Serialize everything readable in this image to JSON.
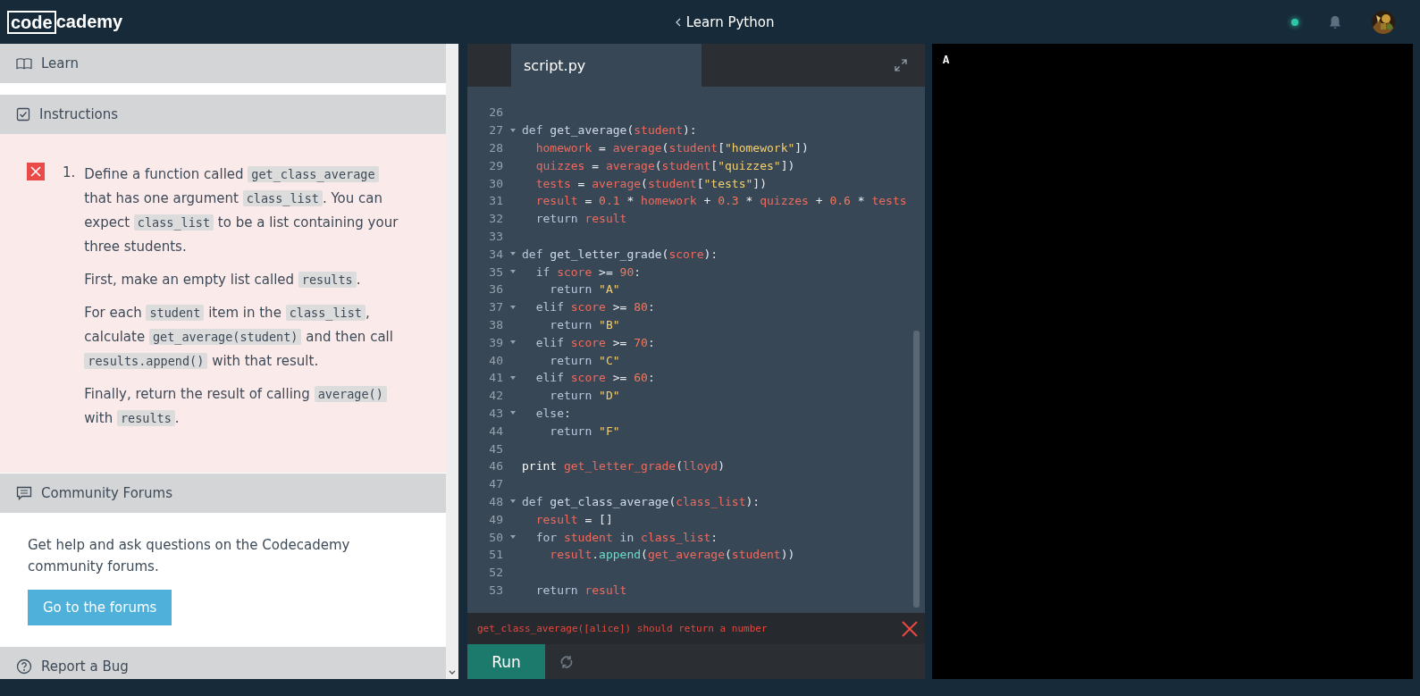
{
  "header": {
    "logo_box": "code",
    "logo_rest": "cademy",
    "course": "Learn Python",
    "online": true
  },
  "sidebar": {
    "learn": {
      "title": "Learn"
    },
    "instructions": {
      "title": "Instructions",
      "items": [
        {
          "number": "1.",
          "passed": false,
          "paragraphs": [
            [
              {
                "text": "Define a function called ",
                "kind": "plain"
              },
              {
                "text": "get_class_average",
                "kind": "code"
              },
              {
                "text": " that has one argument ",
                "kind": "plain"
              },
              {
                "text": "class_list",
                "kind": "code"
              },
              {
                "text": ". You can expect ",
                "kind": "plain"
              },
              {
                "text": "class_list",
                "kind": "code"
              },
              {
                "text": " to be a list containing your three students.",
                "kind": "plain"
              }
            ],
            [
              {
                "text": "First, make an empty list called ",
                "kind": "plain"
              },
              {
                "text": "results",
                "kind": "code"
              },
              {
                "text": ".",
                "kind": "plain"
              }
            ],
            [
              {
                "text": "For each ",
                "kind": "plain"
              },
              {
                "text": "student",
                "kind": "code"
              },
              {
                "text": " item in the ",
                "kind": "plain"
              },
              {
                "text": "class_list",
                "kind": "code"
              },
              {
                "text": ", calculate ",
                "kind": "plain"
              },
              {
                "text": "get_average(student)",
                "kind": "code"
              },
              {
                "text": " and then call ",
                "kind": "plain"
              },
              {
                "text": "results.append()",
                "kind": "code"
              },
              {
                "text": " with that result.",
                "kind": "plain"
              }
            ],
            [
              {
                "text": "Finally, return the result of calling ",
                "kind": "plain"
              },
              {
                "text": "average()",
                "kind": "code"
              },
              {
                "text": " with ",
                "kind": "plain"
              },
              {
                "text": "results",
                "kind": "code"
              },
              {
                "text": ".",
                "kind": "plain"
              }
            ]
          ]
        }
      ]
    },
    "community": {
      "title": "Community Forums",
      "text": "Get help and ask questions on the Codecademy community forums.",
      "button": "Go to the forums"
    },
    "report": {
      "title": "Report a Bug"
    }
  },
  "editor": {
    "tab": "script.py",
    "lines": [
      {
        "n": "26",
        "fold": false
      },
      {
        "n": "27",
        "fold": true,
        "tokens": [
          {
            "text": "def ",
            "kind": "kw"
          },
          {
            "text": "get_average",
            "kind": "fn"
          },
          {
            "text": "(",
            "kind": "p"
          },
          {
            "text": "student",
            "kind": "v"
          },
          {
            "text": "):",
            "kind": "p"
          }
        ]
      },
      {
        "n": "28",
        "fold": false,
        "tokens": [
          {
            "text": "  homework",
            "kind": "v"
          },
          {
            "text": " = ",
            "kind": "p"
          },
          {
            "text": "average",
            "kind": "v"
          },
          {
            "text": "(",
            "kind": "p"
          },
          {
            "text": "student",
            "kind": "v"
          },
          {
            "text": "[",
            "kind": "p"
          },
          {
            "text": "\"homework\"",
            "kind": "s"
          },
          {
            "text": "])",
            "kind": "p"
          }
        ]
      },
      {
        "n": "29",
        "fold": false,
        "tokens": [
          {
            "text": "  quizzes",
            "kind": "v"
          },
          {
            "text": " = ",
            "kind": "p"
          },
          {
            "text": "average",
            "kind": "v"
          },
          {
            "text": "(",
            "kind": "p"
          },
          {
            "text": "student",
            "kind": "v"
          },
          {
            "text": "[",
            "kind": "p"
          },
          {
            "text": "\"quizzes\"",
            "kind": "s"
          },
          {
            "text": "])",
            "kind": "p"
          }
        ]
      },
      {
        "n": "30",
        "fold": false,
        "tokens": [
          {
            "text": "  tests",
            "kind": "v"
          },
          {
            "text": " = ",
            "kind": "p"
          },
          {
            "text": "average",
            "kind": "v"
          },
          {
            "text": "(",
            "kind": "p"
          },
          {
            "text": "student",
            "kind": "v"
          },
          {
            "text": "[",
            "kind": "p"
          },
          {
            "text": "\"tests\"",
            "kind": "s"
          },
          {
            "text": "])",
            "kind": "p"
          }
        ]
      },
      {
        "n": "31",
        "fold": false,
        "tokens": [
          {
            "text": "  result",
            "kind": "v"
          },
          {
            "text": " = ",
            "kind": "p"
          },
          {
            "text": "0.1",
            "kind": "num"
          },
          {
            "text": " * ",
            "kind": "p"
          },
          {
            "text": "homework",
            "kind": "v"
          },
          {
            "text": " + ",
            "kind": "p"
          },
          {
            "text": "0.3",
            "kind": "num"
          },
          {
            "text": " * ",
            "kind": "p"
          },
          {
            "text": "quizzes",
            "kind": "v"
          },
          {
            "text": " + ",
            "kind": "p"
          },
          {
            "text": "0.6",
            "kind": "num"
          },
          {
            "text": " * ",
            "kind": "p"
          },
          {
            "text": "tests",
            "kind": "v"
          }
        ]
      },
      {
        "n": "32",
        "fold": false,
        "tokens": [
          {
            "text": "  return ",
            "kind": "kw"
          },
          {
            "text": "result",
            "kind": "v"
          }
        ]
      },
      {
        "n": "33",
        "fold": false
      },
      {
        "n": "34",
        "fold": true,
        "tokens": [
          {
            "text": "def ",
            "kind": "kw"
          },
          {
            "text": "get_letter_grade",
            "kind": "fn"
          },
          {
            "text": "(",
            "kind": "p"
          },
          {
            "text": "score",
            "kind": "v"
          },
          {
            "text": "):",
            "kind": "p"
          }
        ]
      },
      {
        "n": "35",
        "fold": true,
        "tokens": [
          {
            "text": "  if ",
            "kind": "kw"
          },
          {
            "text": "score",
            "kind": "v"
          },
          {
            "text": " >= ",
            "kind": "p"
          },
          {
            "text": "90",
            "kind": "num"
          },
          {
            "text": ":",
            "kind": "p"
          }
        ]
      },
      {
        "n": "36",
        "fold": false,
        "tokens": [
          {
            "text": "    return ",
            "kind": "kw"
          },
          {
            "text": "\"A\"",
            "kind": "s"
          }
        ]
      },
      {
        "n": "37",
        "fold": true,
        "tokens": [
          {
            "text": "  elif ",
            "kind": "kw"
          },
          {
            "text": "score",
            "kind": "v"
          },
          {
            "text": " >= ",
            "kind": "p"
          },
          {
            "text": "80",
            "kind": "num"
          },
          {
            "text": ":",
            "kind": "p"
          }
        ]
      },
      {
        "n": "38",
        "fold": false,
        "tokens": [
          {
            "text": "    return ",
            "kind": "kw"
          },
          {
            "text": "\"B\"",
            "kind": "s"
          }
        ]
      },
      {
        "n": "39",
        "fold": true,
        "tokens": [
          {
            "text": "  elif ",
            "kind": "kw"
          },
          {
            "text": "score",
            "kind": "v"
          },
          {
            "text": " >= ",
            "kind": "p"
          },
          {
            "text": "70",
            "kind": "num"
          },
          {
            "text": ":",
            "kind": "p"
          }
        ]
      },
      {
        "n": "40",
        "fold": false,
        "tokens": [
          {
            "text": "    return ",
            "kind": "kw"
          },
          {
            "text": "\"C\"",
            "kind": "s"
          }
        ]
      },
      {
        "n": "41",
        "fold": true,
        "tokens": [
          {
            "text": "  elif ",
            "kind": "kw"
          },
          {
            "text": "score",
            "kind": "v"
          },
          {
            "text": " >= ",
            "kind": "p"
          },
          {
            "text": "60",
            "kind": "num"
          },
          {
            "text": ":",
            "kind": "p"
          }
        ]
      },
      {
        "n": "42",
        "fold": false,
        "tokens": [
          {
            "text": "    return ",
            "kind": "kw"
          },
          {
            "text": "\"D\"",
            "kind": "s"
          }
        ]
      },
      {
        "n": "43",
        "fold": true,
        "tokens": [
          {
            "text": "  else",
            "kind": "kw"
          },
          {
            "text": ":",
            "kind": "p"
          }
        ]
      },
      {
        "n": "44",
        "fold": false,
        "tokens": [
          {
            "text": "    return ",
            "kind": "kw"
          },
          {
            "text": "\"F\"",
            "kind": "s"
          }
        ]
      },
      {
        "n": "45",
        "fold": false
      },
      {
        "n": "46",
        "fold": false,
        "tokens": [
          {
            "text": "print ",
            "kind": "pr"
          },
          {
            "text": "get_letter_grade",
            "kind": "v"
          },
          {
            "text": "(",
            "kind": "p"
          },
          {
            "text": "lloyd",
            "kind": "v"
          },
          {
            "text": ")",
            "kind": "p"
          }
        ]
      },
      {
        "n": "47",
        "fold": false
      },
      {
        "n": "48",
        "fold": true,
        "tokens": [
          {
            "text": "def ",
            "kind": "kw"
          },
          {
            "text": "get_class_average",
            "kind": "fn"
          },
          {
            "text": "(",
            "kind": "p"
          },
          {
            "text": "class_list",
            "kind": "v"
          },
          {
            "text": "):",
            "kind": "p"
          }
        ]
      },
      {
        "n": "49",
        "fold": false,
        "tokens": [
          {
            "text": "  result",
            "kind": "v"
          },
          {
            "text": " = ",
            "kind": "p"
          },
          {
            "text": "[]",
            "kind": "p"
          }
        ]
      },
      {
        "n": "50",
        "fold": true,
        "tokens": [
          {
            "text": "  for ",
            "kind": "kw"
          },
          {
            "text": "student",
            "kind": "v"
          },
          {
            "text": " in ",
            "kind": "kw"
          },
          {
            "text": "class_list",
            "kind": "v"
          },
          {
            "text": ":",
            "kind": "p"
          }
        ]
      },
      {
        "n": "51",
        "fold": false,
        "tokens": [
          {
            "text": "    result",
            "kind": "v"
          },
          {
            "text": ".",
            "kind": "p"
          },
          {
            "text": "append",
            "kind": "m"
          },
          {
            "text": "(",
            "kind": "p"
          },
          {
            "text": "get_average",
            "kind": "v"
          },
          {
            "text": "(",
            "kind": "p"
          },
          {
            "text": "student",
            "kind": "v"
          },
          {
            "text": "))",
            "kind": "p"
          }
        ]
      },
      {
        "n": "52",
        "fold": false
      },
      {
        "n": "53",
        "fold": false,
        "tokens": [
          {
            "text": "  return ",
            "kind": "kw"
          },
          {
            "text": "result",
            "kind": "v"
          }
        ]
      }
    ],
    "error": "get_class_average([alice]) should return a number",
    "run": "Run"
  },
  "console": {
    "output": "A"
  }
}
